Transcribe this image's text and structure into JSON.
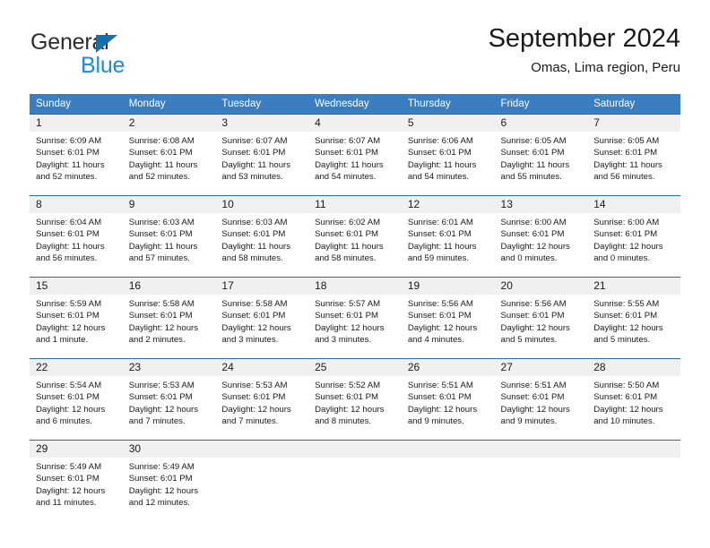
{
  "logo": {
    "word_top": "General",
    "word_bottom": "Blue",
    "triangle_icon": "triangle-icon",
    "color_dark": "#2d2d2d",
    "color_blue": "#1b8ae0"
  },
  "header": {
    "title": "September 2024",
    "subtitle": "Omas, Lima region, Peru"
  },
  "theme": {
    "header_bg": "#3a7ebf",
    "row_border": "#2b6ca8",
    "daynum_bg": "#f0f0f0",
    "text": "#1a1a1a"
  },
  "calendar": {
    "weekday_headers": [
      "Sunday",
      "Monday",
      "Tuesday",
      "Wednesday",
      "Thursday",
      "Friday",
      "Saturday"
    ],
    "weeks": [
      [
        {
          "day": "1",
          "sunrise": "Sunrise: 6:09 AM",
          "sunset": "Sunset: 6:01 PM",
          "daylight_line1": "Daylight: 11 hours",
          "daylight_line2": "and 52 minutes."
        },
        {
          "day": "2",
          "sunrise": "Sunrise: 6:08 AM",
          "sunset": "Sunset: 6:01 PM",
          "daylight_line1": "Daylight: 11 hours",
          "daylight_line2": "and 52 minutes."
        },
        {
          "day": "3",
          "sunrise": "Sunrise: 6:07 AM",
          "sunset": "Sunset: 6:01 PM",
          "daylight_line1": "Daylight: 11 hours",
          "daylight_line2": "and 53 minutes."
        },
        {
          "day": "4",
          "sunrise": "Sunrise: 6:07 AM",
          "sunset": "Sunset: 6:01 PM",
          "daylight_line1": "Daylight: 11 hours",
          "daylight_line2": "and 54 minutes."
        },
        {
          "day": "5",
          "sunrise": "Sunrise: 6:06 AM",
          "sunset": "Sunset: 6:01 PM",
          "daylight_line1": "Daylight: 11 hours",
          "daylight_line2": "and 54 minutes."
        },
        {
          "day": "6",
          "sunrise": "Sunrise: 6:05 AM",
          "sunset": "Sunset: 6:01 PM",
          "daylight_line1": "Daylight: 11 hours",
          "daylight_line2": "and 55 minutes."
        },
        {
          "day": "7",
          "sunrise": "Sunrise: 6:05 AM",
          "sunset": "Sunset: 6:01 PM",
          "daylight_line1": "Daylight: 11 hours",
          "daylight_line2": "and 56 minutes."
        }
      ],
      [
        {
          "day": "8",
          "sunrise": "Sunrise: 6:04 AM",
          "sunset": "Sunset: 6:01 PM",
          "daylight_line1": "Daylight: 11 hours",
          "daylight_line2": "and 56 minutes."
        },
        {
          "day": "9",
          "sunrise": "Sunrise: 6:03 AM",
          "sunset": "Sunset: 6:01 PM",
          "daylight_line1": "Daylight: 11 hours",
          "daylight_line2": "and 57 minutes."
        },
        {
          "day": "10",
          "sunrise": "Sunrise: 6:03 AM",
          "sunset": "Sunset: 6:01 PM",
          "daylight_line1": "Daylight: 11 hours",
          "daylight_line2": "and 58 minutes."
        },
        {
          "day": "11",
          "sunrise": "Sunrise: 6:02 AM",
          "sunset": "Sunset: 6:01 PM",
          "daylight_line1": "Daylight: 11 hours",
          "daylight_line2": "and 58 minutes."
        },
        {
          "day": "12",
          "sunrise": "Sunrise: 6:01 AM",
          "sunset": "Sunset: 6:01 PM",
          "daylight_line1": "Daylight: 11 hours",
          "daylight_line2": "and 59 minutes."
        },
        {
          "day": "13",
          "sunrise": "Sunrise: 6:00 AM",
          "sunset": "Sunset: 6:01 PM",
          "daylight_line1": "Daylight: 12 hours",
          "daylight_line2": "and 0 minutes."
        },
        {
          "day": "14",
          "sunrise": "Sunrise: 6:00 AM",
          "sunset": "Sunset: 6:01 PM",
          "daylight_line1": "Daylight: 12 hours",
          "daylight_line2": "and 0 minutes."
        }
      ],
      [
        {
          "day": "15",
          "sunrise": "Sunrise: 5:59 AM",
          "sunset": "Sunset: 6:01 PM",
          "daylight_line1": "Daylight: 12 hours",
          "daylight_line2": "and 1 minute."
        },
        {
          "day": "16",
          "sunrise": "Sunrise: 5:58 AM",
          "sunset": "Sunset: 6:01 PM",
          "daylight_line1": "Daylight: 12 hours",
          "daylight_line2": "and 2 minutes."
        },
        {
          "day": "17",
          "sunrise": "Sunrise: 5:58 AM",
          "sunset": "Sunset: 6:01 PM",
          "daylight_line1": "Daylight: 12 hours",
          "daylight_line2": "and 3 minutes."
        },
        {
          "day": "18",
          "sunrise": "Sunrise: 5:57 AM",
          "sunset": "Sunset: 6:01 PM",
          "daylight_line1": "Daylight: 12 hours",
          "daylight_line2": "and 3 minutes."
        },
        {
          "day": "19",
          "sunrise": "Sunrise: 5:56 AM",
          "sunset": "Sunset: 6:01 PM",
          "daylight_line1": "Daylight: 12 hours",
          "daylight_line2": "and 4 minutes."
        },
        {
          "day": "20",
          "sunrise": "Sunrise: 5:56 AM",
          "sunset": "Sunset: 6:01 PM",
          "daylight_line1": "Daylight: 12 hours",
          "daylight_line2": "and 5 minutes."
        },
        {
          "day": "21",
          "sunrise": "Sunrise: 5:55 AM",
          "sunset": "Sunset: 6:01 PM",
          "daylight_line1": "Daylight: 12 hours",
          "daylight_line2": "and 5 minutes."
        }
      ],
      [
        {
          "day": "22",
          "sunrise": "Sunrise: 5:54 AM",
          "sunset": "Sunset: 6:01 PM",
          "daylight_line1": "Daylight: 12 hours",
          "daylight_line2": "and 6 minutes."
        },
        {
          "day": "23",
          "sunrise": "Sunrise: 5:53 AM",
          "sunset": "Sunset: 6:01 PM",
          "daylight_line1": "Daylight: 12 hours",
          "daylight_line2": "and 7 minutes."
        },
        {
          "day": "24",
          "sunrise": "Sunrise: 5:53 AM",
          "sunset": "Sunset: 6:01 PM",
          "daylight_line1": "Daylight: 12 hours",
          "daylight_line2": "and 7 minutes."
        },
        {
          "day": "25",
          "sunrise": "Sunrise: 5:52 AM",
          "sunset": "Sunset: 6:01 PM",
          "daylight_line1": "Daylight: 12 hours",
          "daylight_line2": "and 8 minutes."
        },
        {
          "day": "26",
          "sunrise": "Sunrise: 5:51 AM",
          "sunset": "Sunset: 6:01 PM",
          "daylight_line1": "Daylight: 12 hours",
          "daylight_line2": "and 9 minutes."
        },
        {
          "day": "27",
          "sunrise": "Sunrise: 5:51 AM",
          "sunset": "Sunset: 6:01 PM",
          "daylight_line1": "Daylight: 12 hours",
          "daylight_line2": "and 9 minutes."
        },
        {
          "day": "28",
          "sunrise": "Sunrise: 5:50 AM",
          "sunset": "Sunset: 6:01 PM",
          "daylight_line1": "Daylight: 12 hours",
          "daylight_line2": "and 10 minutes."
        }
      ],
      [
        {
          "day": "29",
          "sunrise": "Sunrise: 5:49 AM",
          "sunset": "Sunset: 6:01 PM",
          "daylight_line1": "Daylight: 12 hours",
          "daylight_line2": "and 11 minutes."
        },
        {
          "day": "30",
          "sunrise": "Sunrise: 5:49 AM",
          "sunset": "Sunset: 6:01 PM",
          "daylight_line1": "Daylight: 12 hours",
          "daylight_line2": "and 12 minutes."
        },
        {
          "day": "",
          "sunrise": "",
          "sunset": "",
          "daylight_line1": "",
          "daylight_line2": ""
        },
        {
          "day": "",
          "sunrise": "",
          "sunset": "",
          "daylight_line1": "",
          "daylight_line2": ""
        },
        {
          "day": "",
          "sunrise": "",
          "sunset": "",
          "daylight_line1": "",
          "daylight_line2": ""
        },
        {
          "day": "",
          "sunrise": "",
          "sunset": "",
          "daylight_line1": "",
          "daylight_line2": ""
        },
        {
          "day": "",
          "sunrise": "",
          "sunset": "",
          "daylight_line1": "",
          "daylight_line2": ""
        }
      ]
    ]
  }
}
